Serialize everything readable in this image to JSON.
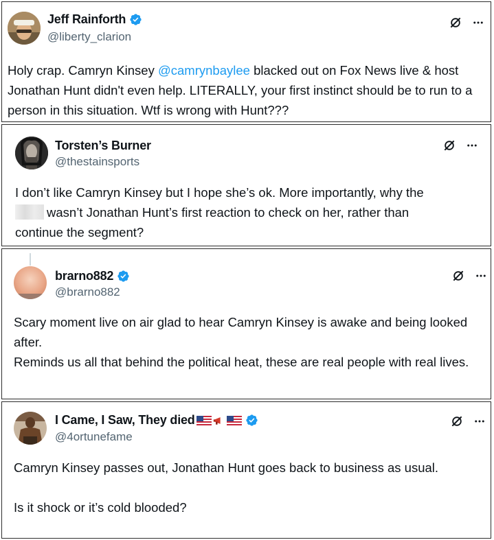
{
  "posts": [
    {
      "name": "Jeff Rainforth",
      "verified": true,
      "handle": "@liberty_clarion",
      "text_before": "Holy crap. Camryn Kinsey ",
      "mention": "@camrynbaylee",
      "text_after": " blacked out on Fox News live & host Jonathan Hunt didn't even help. LITERALLY, your first instinct should be to run to a person in this situation. Wtf is wrong with Hunt???"
    },
    {
      "name": "Torsten’s Burner",
      "verified": false,
      "handle": "@thestainsports",
      "line1": "I don’t like Camryn Kinsey but I hope she’s ok. More importantly, why the",
      "line2": "wasn’t Jonathan Hunt’s first reaction to check on her, rather than",
      "line3": "continue the segment?"
    },
    {
      "name": "brarno882",
      "verified": true,
      "handle": "@brarno882",
      "para1": "Scary moment live on air glad to hear Camryn Kinsey is awake and being looked after.",
      "para2": "Reminds us all that behind the political heat, these are real people with real lives."
    },
    {
      "name": "I Came, I Saw, They died",
      "verified": true,
      "handle": "@4ortunefame",
      "para1": "Camryn Kinsey passes out, Jonathan Hunt goes back to business as usual.",
      "para2": "Is it shock or it’s cold blooded?"
    }
  ],
  "icons": {
    "verified": "verified-badge-icon",
    "grok": "grok-icon",
    "more": "more-options-icon"
  },
  "colors": {
    "mention": "#1d9bf0",
    "verified": "#1d9bf0",
    "handle": "#536471",
    "text": "#0f1419"
  }
}
